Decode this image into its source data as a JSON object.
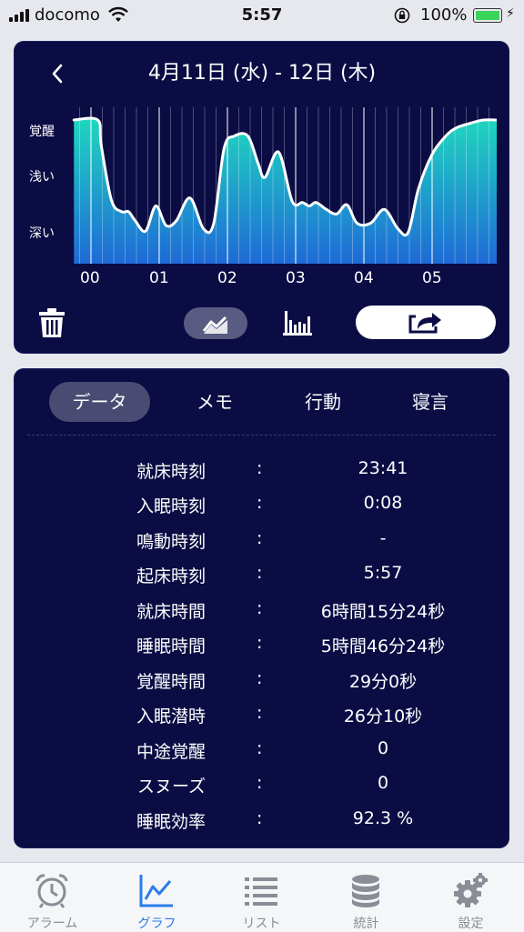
{
  "status_bar": {
    "carrier": "docomo",
    "time": "5:57",
    "battery": "100%"
  },
  "graph": {
    "title": "4月11日 (水) - 12日 (木)",
    "y_labels": [
      "覚醒",
      "浅い",
      "深い"
    ],
    "x_labels": [
      "00",
      "01",
      "02",
      "03",
      "04",
      "05"
    ],
    "colors": {
      "panel": "#0b0c44",
      "gradient_top": "#1fd7bf",
      "gradient_bottom": "#1e6ad6"
    }
  },
  "chart_data": {
    "type": "area",
    "title": "4月11日 (水) - 12日 (木)",
    "y_categories": [
      "深い",
      "浅い",
      "覚醒"
    ],
    "ylim": [
      0,
      1
    ],
    "x_ticks": [
      "00",
      "01",
      "02",
      "03",
      "04",
      "05"
    ],
    "x": [
      -0.25,
      0.1,
      0.15,
      0.3,
      0.45,
      0.55,
      0.65,
      0.8,
      0.95,
      1.1,
      1.25,
      1.45,
      1.65,
      1.8,
      1.95,
      2.1,
      2.3,
      2.45,
      2.55,
      2.75,
      2.95,
      3.1,
      3.2,
      3.3,
      3.45,
      3.6,
      3.75,
      3.9,
      4.1,
      4.3,
      4.5,
      4.65,
      4.8,
      5.0,
      5.2,
      5.35,
      5.55,
      5.75,
      6.0
    ],
    "values": [
      1.0,
      1.0,
      0.78,
      0.3,
      0.2,
      0.2,
      0.12,
      0.03,
      0.25,
      0.08,
      0.12,
      0.32,
      0.05,
      0.1,
      0.75,
      0.86,
      0.86,
      0.62,
      0.5,
      0.72,
      0.29,
      0.28,
      0.25,
      0.28,
      0.22,
      0.18,
      0.26,
      0.1,
      0.1,
      0.22,
      0.05,
      0.02,
      0.4,
      0.7,
      0.86,
      0.93,
      0.97,
      1.0,
      1.0
    ]
  },
  "toolbar": {
    "trash": "trash-icon",
    "line_chart": "line-chart-icon",
    "bar_chart": "bar-chart-icon",
    "share": "share-icon"
  },
  "tabs": [
    "データ",
    "メモ",
    "行動",
    "寝言"
  ],
  "rows": [
    {
      "label": "就床時刻",
      "colon": ":",
      "value": "23:41"
    },
    {
      "label": "入眠時刻",
      "colon": ":",
      "value": "0:08"
    },
    {
      "label": "鳴動時刻",
      "colon": ":",
      "value": "-"
    },
    {
      "label": "起床時刻",
      "colon": ":",
      "value": "5:57"
    },
    {
      "label": "就床時間",
      "colon": ":",
      "value": "6時間15分24秒"
    },
    {
      "label": "睡眠時間",
      "colon": ":",
      "value": "5時間46分24秒"
    },
    {
      "label": "覚醒時間",
      "colon": ":",
      "value": "29分0秒"
    },
    {
      "label": "入眠潜時",
      "colon": ":",
      "value": "26分10秒"
    },
    {
      "label": "中途覚醒",
      "colon": ":",
      "value": "0"
    },
    {
      "label": "スヌーズ",
      "colon": ":",
      "value": "0"
    },
    {
      "label": "睡眠効率",
      "colon": ":",
      "value": "92.3 %"
    }
  ],
  "tab_bar": [
    {
      "label": "アラーム",
      "icon": "alarm-clock-icon"
    },
    {
      "label": "グラフ",
      "icon": "graph-icon"
    },
    {
      "label": "リスト",
      "icon": "list-icon"
    },
    {
      "label": "統計",
      "icon": "database-icon"
    },
    {
      "label": "設定",
      "icon": "gear-icon"
    }
  ]
}
